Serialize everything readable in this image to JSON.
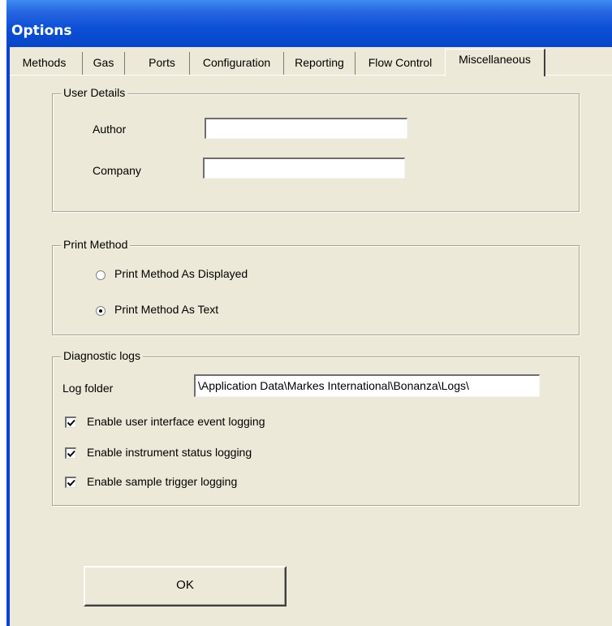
{
  "window": {
    "title": "Options"
  },
  "tabs": [
    {
      "label": "Methods"
    },
    {
      "label": "Gas"
    },
    {
      "label": "Ports"
    },
    {
      "label": "Configuration"
    },
    {
      "label": "Reporting"
    },
    {
      "label": "Flow Control"
    },
    {
      "label": "Miscellaneous",
      "active": true
    }
  ],
  "user_details": {
    "legend": "User Details",
    "author_label": "Author",
    "author_value": "",
    "company_label": "Company",
    "company_value": ""
  },
  "print_method": {
    "legend": "Print Method",
    "options": [
      {
        "label": "Print Method As Displayed",
        "selected": false
      },
      {
        "label": "Print Method As Text",
        "selected": true
      }
    ]
  },
  "diagnostic_logs": {
    "legend": "Diagnostic logs",
    "log_folder_label": "Log folder",
    "log_folder_value": "\\Application Data\\Markes International\\Bonanza\\Logs\\",
    "checkboxes": [
      {
        "label": "Enable user interface event logging",
        "checked": true
      },
      {
        "label": "Enable instrument status logging",
        "checked": true
      },
      {
        "label": "Enable sample trigger logging",
        "checked": true
      }
    ]
  },
  "ok_button": {
    "label": "OK"
  }
}
